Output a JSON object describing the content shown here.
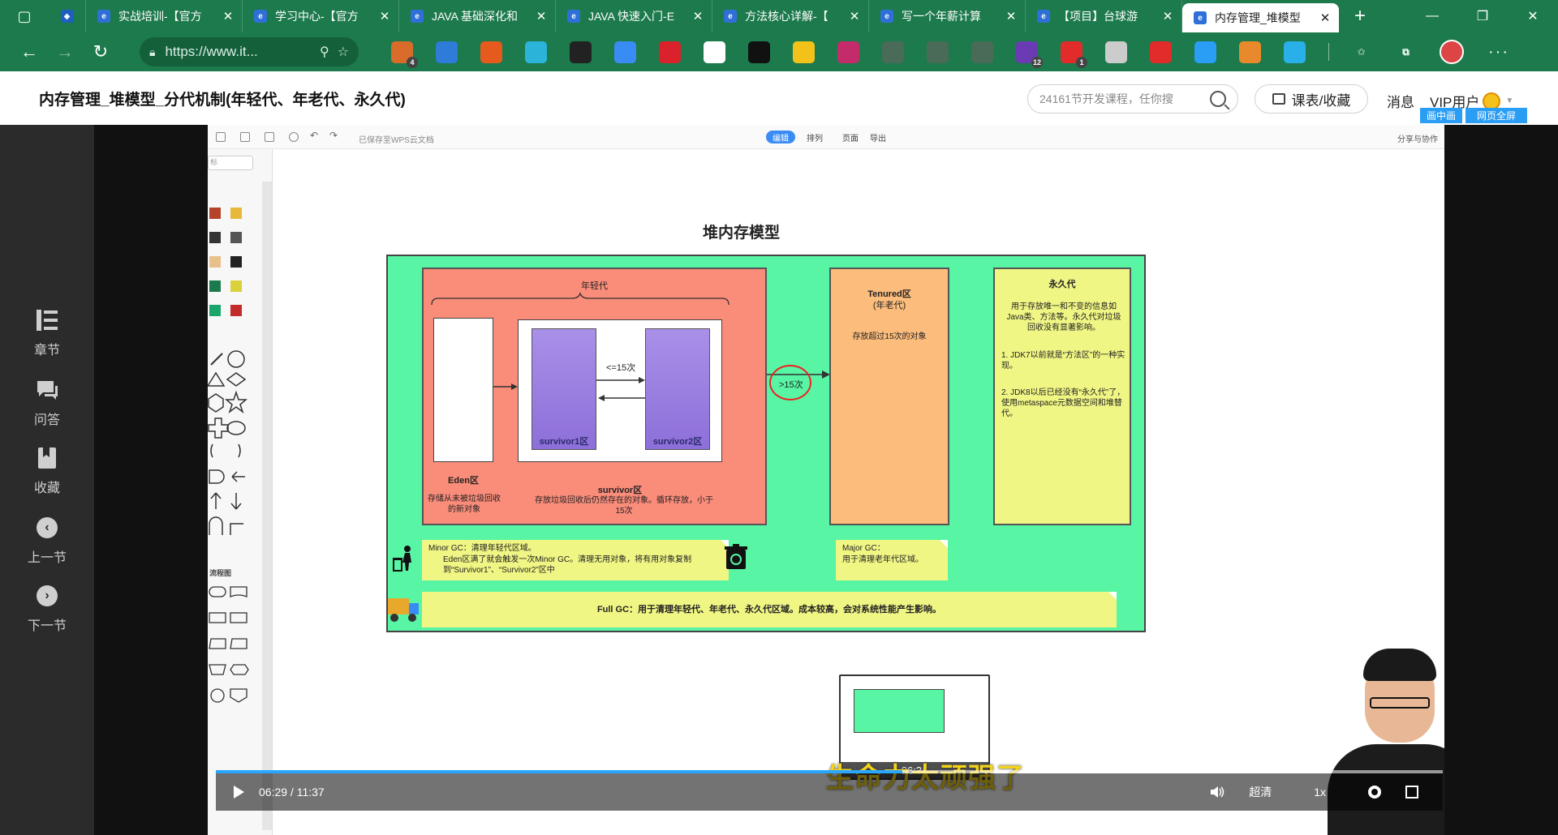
{
  "browser": {
    "tabs": [
      {
        "title": "",
        "pinned": true
      },
      {
        "title": "实战培训-【官方",
        "pinned": false
      },
      {
        "title": "学习中心-【官方",
        "pinned": false
      },
      {
        "title": "JAVA 基础深化和",
        "pinned": false
      },
      {
        "title": "JAVA 快速入门-E",
        "pinned": false
      },
      {
        "title": "方法核心详解-【",
        "pinned": false
      },
      {
        "title": "写一个年薪计算",
        "pinned": false
      },
      {
        "title": "【项目】台球游",
        "pinned": false
      },
      {
        "title": "内存管理_堆模型",
        "pinned": false,
        "active": true
      }
    ],
    "new_tab": "+",
    "url": "https://www.it...",
    "extensions": [
      {
        "name": "puzzle-ext-icon",
        "color": "#d96b2b",
        "badge": "4"
      },
      {
        "name": "translate-ext-icon",
        "color": "#2f7bd8",
        "badge": ""
      },
      {
        "name": "notes-ext-icon",
        "color": "#e65a1e",
        "badge": ""
      },
      {
        "name": "grid-ext-icon",
        "color": "#2bb3d9",
        "badge": ""
      },
      {
        "name": "calculator-ext-icon",
        "color": "#222222",
        "badge": ""
      },
      {
        "name": "gem-ext-icon",
        "color": "#3a8cf5",
        "badge": ""
      },
      {
        "name": "abp-ext-icon",
        "color": "#d9222b",
        "badge": ""
      },
      {
        "name": "mountain-ext-icon",
        "color": "#ffffff",
        "badge": ""
      },
      {
        "name": "asterisk-ext-icon",
        "color": "#111111",
        "badge": ""
      },
      {
        "name": "m-ext-icon",
        "color": "#f2c21a",
        "badge": ""
      },
      {
        "name": "spiral-ext-icon",
        "color": "#c42b6b",
        "badge": ""
      },
      {
        "name": "brackets-ext-icon",
        "color": "#4a6b58",
        "badge": ""
      },
      {
        "name": "diamond-ext-icon",
        "color": "#4a6b58",
        "badge": ""
      },
      {
        "name": "code-ext-icon",
        "color": "#4a6b58",
        "badge": ""
      },
      {
        "name": "hat-ext-icon",
        "color": "#6a3bb3",
        "badge": "12"
      },
      {
        "name": "cubes-ext-icon",
        "color": "#e22b2b",
        "badge": "1"
      },
      {
        "name": "camera-ext-icon",
        "color": "#cccccc",
        "badge": ""
      },
      {
        "name": "circle-ext-icon",
        "color": "#e22b2b",
        "badge": ""
      },
      {
        "name": "ring-ext-icon",
        "color": "#2a9df4",
        "badge": ""
      },
      {
        "name": "fox-ext-icon",
        "color": "#e88a2b",
        "badge": ""
      },
      {
        "name": "shield-ext-icon",
        "color": "#2ab0e8",
        "badge": ""
      }
    ]
  },
  "header": {
    "course_title": "内存管理_堆模型_分代机制(年轻代、年老代、永久代)",
    "search_placeholder": "24161节开发课程，任你搜",
    "course_button": "课表/收藏",
    "messages": "消息",
    "vip": "VIP用户",
    "pip": "画中画",
    "fullpage": "网页全屏"
  },
  "left_panel": [
    {
      "label": "章节",
      "icon": "chapters-icon"
    },
    {
      "label": "问答",
      "icon": "qa-icon"
    },
    {
      "label": "收藏",
      "icon": "bookmark-icon"
    },
    {
      "label": "上一节",
      "icon": "prev-icon"
    },
    {
      "label": "下一节",
      "icon": "next-icon"
    }
  ],
  "wps": {
    "saved": "已保存至WPS云文档",
    "tabs": [
      "编辑",
      "排列",
      "页面",
      "导出"
    ],
    "share": "分享与协作",
    "shape_search": "标",
    "section_flowchart": "流程图"
  },
  "diagram": {
    "title": "堆内存模型",
    "young_gen": "年轻代",
    "eden_label": "Eden区",
    "eden_desc": "存储从未被垃圾回收的新对象",
    "lt15": "<=15次",
    "survivor1": "survivor1区",
    "survivor2": "survivor2区",
    "survivor_label": "survivor区",
    "survivor_desc": "存放垃圾回收后仍然存在的对象。循环存放，小于15次",
    "gt15": ">15次",
    "tenured_title": "Tenured区",
    "tenured_sub": "(年老代)",
    "tenured_desc": "存放超过15次的对象",
    "perm_title": "永久代",
    "perm_desc": "用于存放唯一和不变的信息如Java类、方法等。永久代对垃圾回收没有显著影响。",
    "perm_jdk7": "1. JDK7以前就是“方法区”的一种实现。",
    "perm_jdk8": "2. JDK8以后已经没有“永久代”了，使用metaspace元数据空间和堆替代。",
    "minor_gc": "Minor GC：清理年轻代区域。",
    "minor_gc_detail": "Eden区满了就会触发一次Minor GC。清理无用对象，将有用对象复制到“Survivor1”、“Survivor2”区中",
    "major_gc": "Major GC：",
    "major_gc_detail": "用于清理老年代区域。",
    "full_gc": "Full GC：用于清理年轻代、年老代、永久代区域。成本较高，会对系统性能产生影响。"
  },
  "player": {
    "subtitle": "生命力太顽强了",
    "thumb_time": "06:34",
    "time": "06:29 / 11:37",
    "progress": 0.5595,
    "quality": "超清",
    "speed": "1x"
  }
}
